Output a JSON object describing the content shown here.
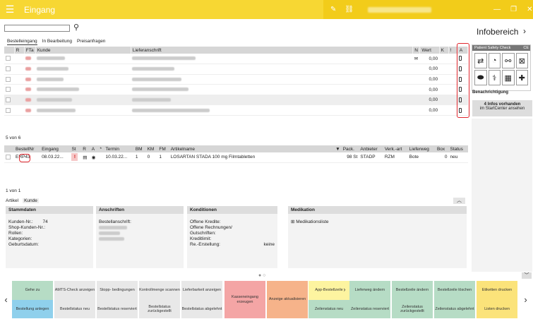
{
  "app": {
    "title": "Eingang",
    "menu_icon": "hamburger-icon"
  },
  "search": {
    "placeholder": "",
    "value": ""
  },
  "tabs": [
    "Bestelleingang",
    "In Bearbeitung",
    "Preisanfragen"
  ],
  "grid1": {
    "headers": [
      "R",
      "FTa",
      "Kunde",
      "Lieferanschrift",
      "N",
      "Wert",
      "K",
      "!",
      "A"
    ],
    "rows": [
      {
        "wert": "0,00",
        "mail": true
      },
      {
        "wert": "0,00",
        "mail": false
      },
      {
        "wert": "0,00",
        "mail": false
      },
      {
        "wert": "0,00",
        "mail": false
      },
      {
        "wert": "0,00",
        "mail": false
      },
      {
        "wert": "0,00",
        "mail": false
      }
    ]
  },
  "count1": "5 von 6",
  "grid2": {
    "headers": [
      "BestellNr",
      "Eingang",
      "St",
      "R",
      "A",
      "*",
      "Termin",
      "BM",
      "KM",
      "FM",
      "Artikelname",
      "Pack.",
      "Anbieter",
      "Verk.-art",
      "Lieferweg",
      "Box",
      "Status"
    ],
    "row": {
      "bestellnr": "ERP43",
      "eingang": "08.03.22...",
      "termin": "10.03.22...",
      "bm": "1",
      "km": "0",
      "fm": "1",
      "artikel": "LOSARTAN STADA 100 mg Filmtabletten",
      "pack": "98 St",
      "anbieter": "STADP",
      "verkart": "RZM",
      "lieferweg": "Bote",
      "box": "0",
      "status": "neu"
    }
  },
  "count2": "1 von 1",
  "subtabs": [
    "Artikel",
    "Kunde"
  ],
  "panels": {
    "stammdaten": {
      "title": "Stammdaten",
      "lines": [
        "Kunden-Nr.:",
        "Shop-Kunden-Nr.:",
        "Rollen:",
        "Kategorien:",
        "Geburtsdatum:"
      ],
      "kunden_nr": "74"
    },
    "anschriften": {
      "title": "Anschriften",
      "lines": [
        "Bestellanschrift:"
      ]
    },
    "konditionen": {
      "title": "Konditionen",
      "lines": [
        "Offene Kredite:",
        "Offene Rechnungen/ Gutschriften:",
        "Kreditlimit:",
        "Re.-Erstellung:"
      ],
      "re_value": "keine"
    },
    "medikation": {
      "title": "Medikation",
      "item": "Medikationsliste"
    }
  },
  "info": {
    "title": "Infobereich",
    "psc_title": "Patient Safety Check",
    "notif_title": "Benachrichtigung",
    "notif_count": "4 Infos vorhanden",
    "notif_sub": "im StartCenter ansehen"
  },
  "buttons": [
    {
      "label": "Gehe zu",
      "color": "#b6dcc5"
    },
    {
      "label": "AMTS-Check anzeigen",
      "color": "#e8e8e8"
    },
    {
      "label": "Stopp- bedingungen",
      "color": "#e8e8e8"
    },
    {
      "label": "Kontrollmenge scannen",
      "color": "#e8e8e8"
    },
    {
      "label": "Lieferbarkeit anzeigen",
      "color": "#e8e8e8"
    },
    {
      "label": "Kasseneingang erzeugen",
      "color": "#f4a5a5"
    },
    {
      "label": "Anzeige aktualisieren",
      "color": "#f6b38a"
    },
    {
      "label": "App-Bestellzeile",
      "color": "#fdf4a0"
    },
    {
      "label": "Lieferweg ändern",
      "color": "#b6dcc5"
    },
    {
      "label": "Bestellzeile ändern",
      "color": "#b6dcc5"
    },
    {
      "label": "Bestellzeile löschen",
      "color": "#b6dcc5"
    },
    {
      "label": "Etiketten drucken",
      "color": "#fbe37a"
    },
    {
      "label": "Bestellung anlegen",
      "color": "#8fd0ec"
    },
    {
      "label": "Bestellstatus neu",
      "color": "#e8e8e8"
    },
    {
      "label": "Bestellstatus reserviert",
      "color": "#e8e8e8"
    },
    {
      "label": "Bestellstatus zurückgestellt",
      "color": "#e8e8e8"
    },
    {
      "label": "Bestellstatus abgelehnt",
      "color": "#e8e8e8"
    },
    {
      "label": "Zeilenstatus neu",
      "color": "#b6dcc5"
    },
    {
      "label": "Zeilenstatus reserviert",
      "color": "#b6dcc5"
    },
    {
      "label": "Zeilenstatus zurückgestellt",
      "color": "#b6dcc5"
    },
    {
      "label": "Zeilenstatus abgelehnt",
      "color": "#b6dcc5"
    },
    {
      "label": "Listen drucken",
      "color": "#fbe37a"
    }
  ]
}
